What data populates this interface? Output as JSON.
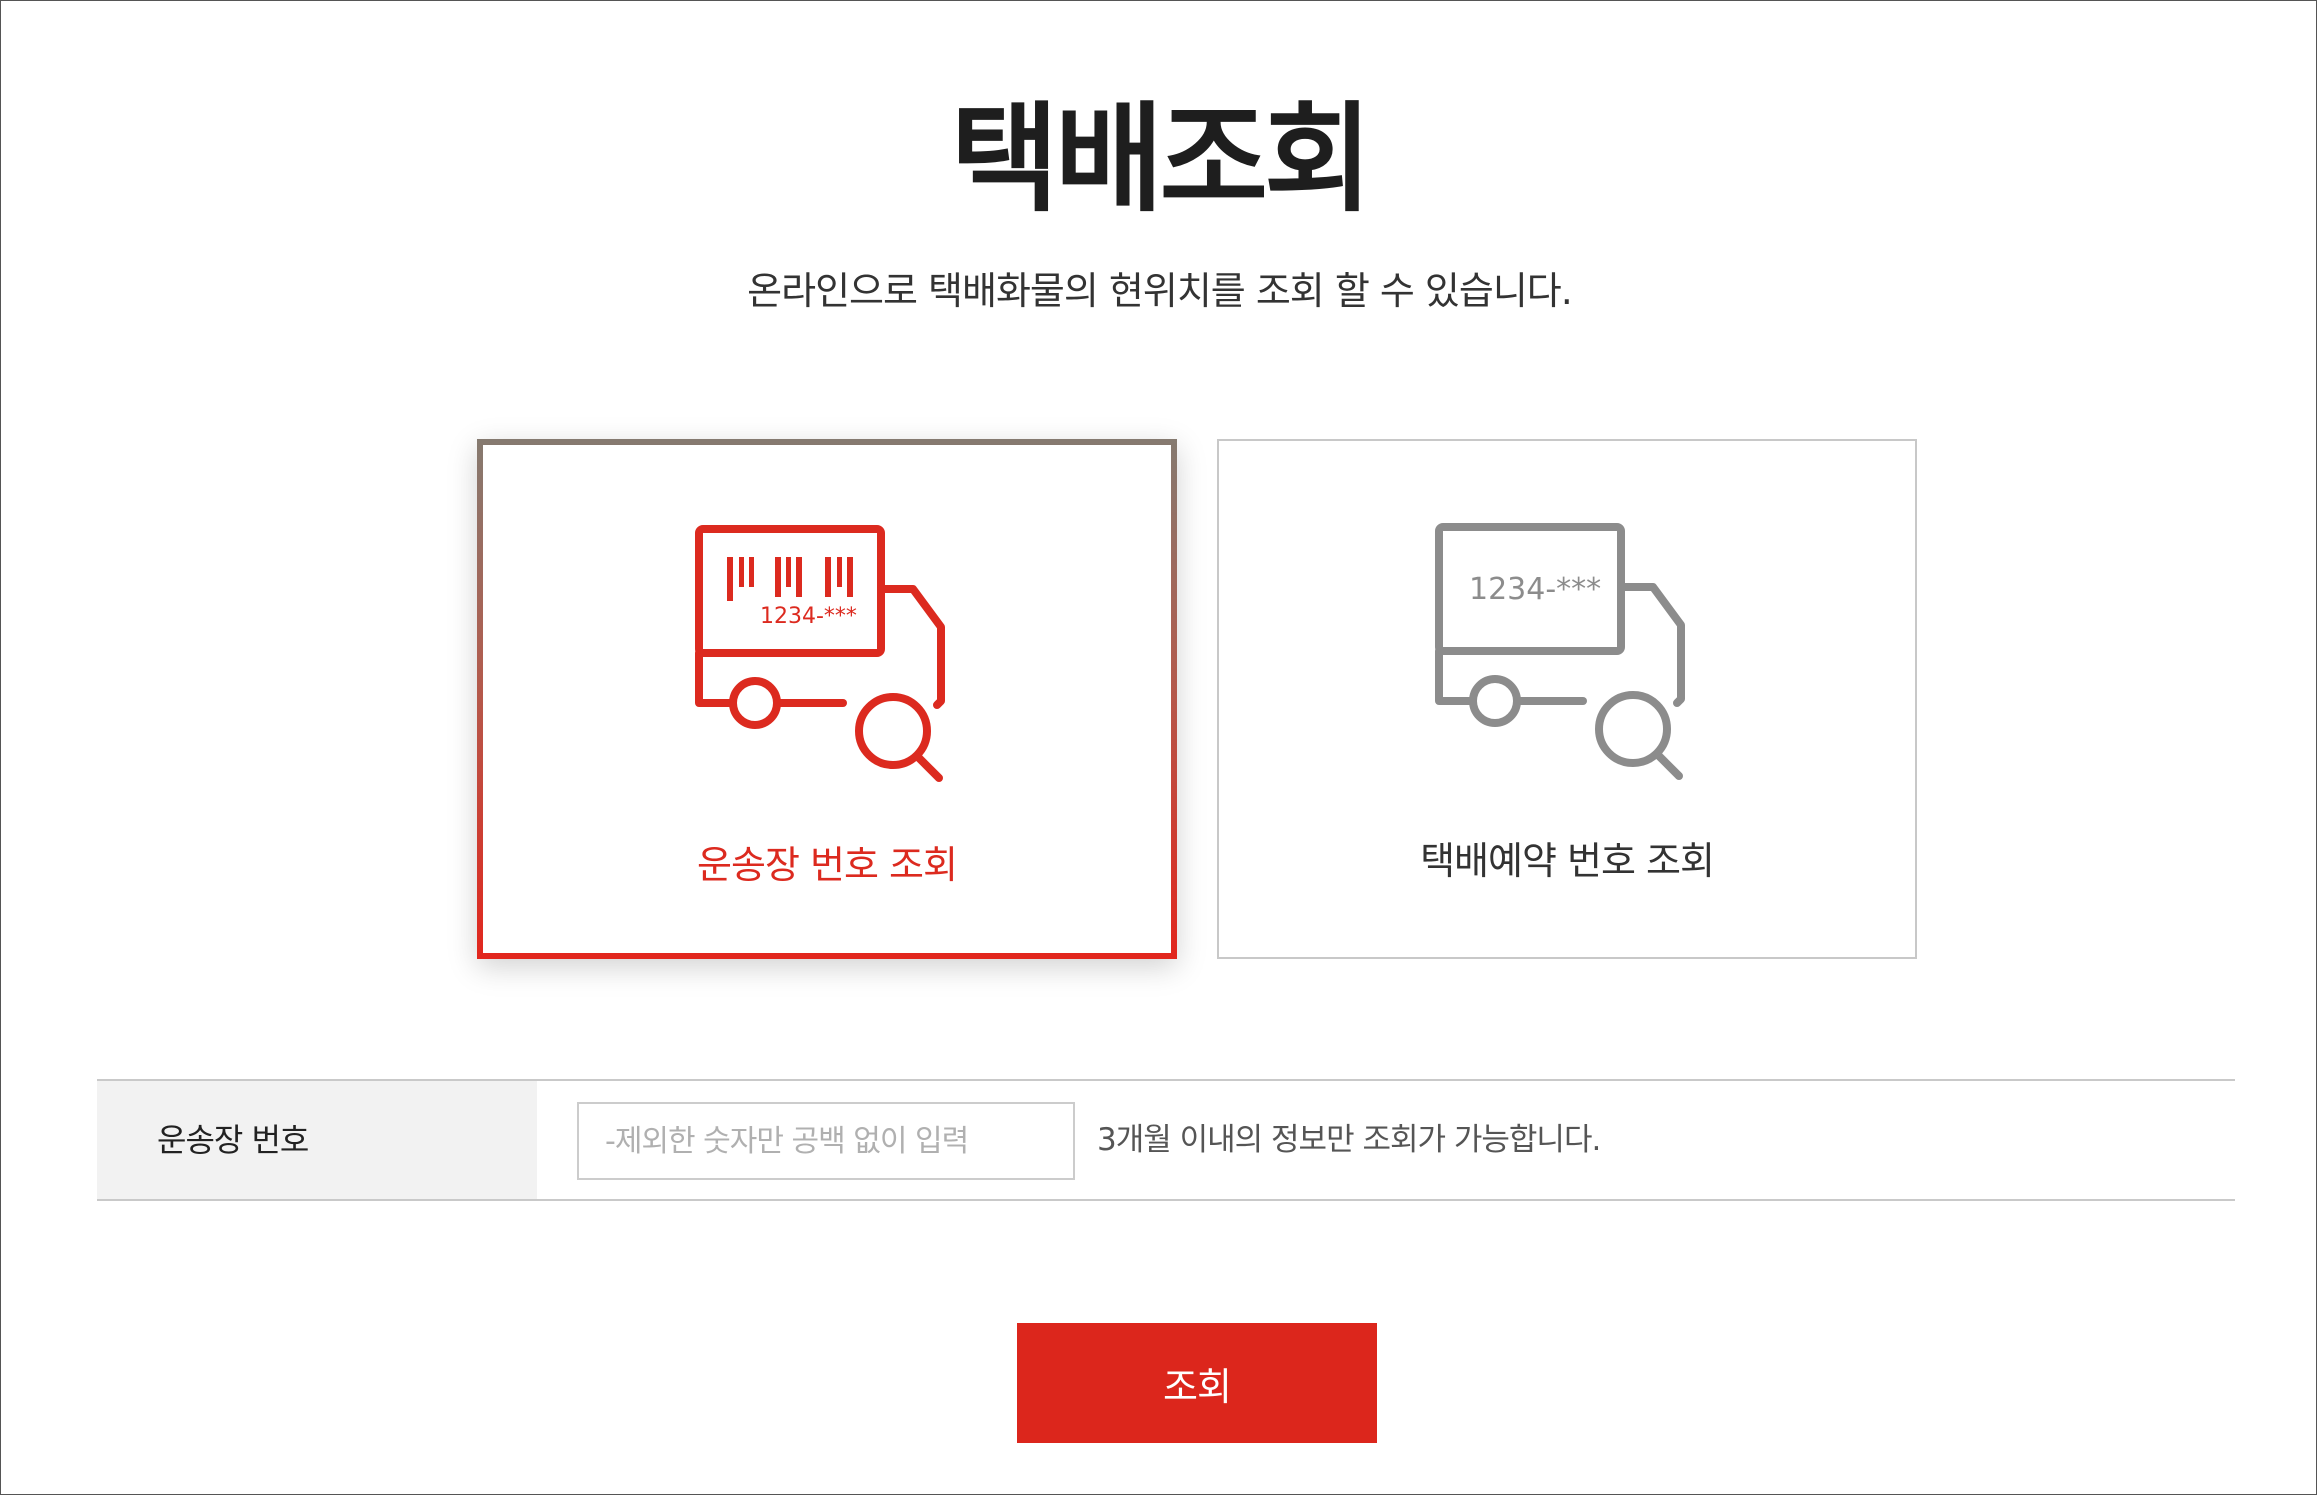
{
  "page": {
    "title": "택배조회",
    "subtitle": "온라인으로 택배화물의 현위치를 조회 할 수 있습니다."
  },
  "search_types": [
    {
      "label": "운송장 번호 조회",
      "icon": "barcode-truck-search-icon",
      "icon_text": "1234-***",
      "selected": true,
      "color": "#dc2a1f"
    },
    {
      "label": "택배예약 번호 조회",
      "icon": "truck-search-icon",
      "icon_text": "1234-***",
      "selected": false,
      "color": "#8c8c8c"
    }
  ],
  "form": {
    "field_label": "운송장 번호",
    "input_value": "",
    "input_placeholder": "-제외한 숫자만 공백 없이 입력",
    "hint": "3개월 이내의 정보만 조회가 가능합니다."
  },
  "submit_label": "조회",
  "colors": {
    "accent": "#dc261c",
    "inactive_icon": "#8c8c8c",
    "label_cell_bg": "#f2f2f2"
  }
}
